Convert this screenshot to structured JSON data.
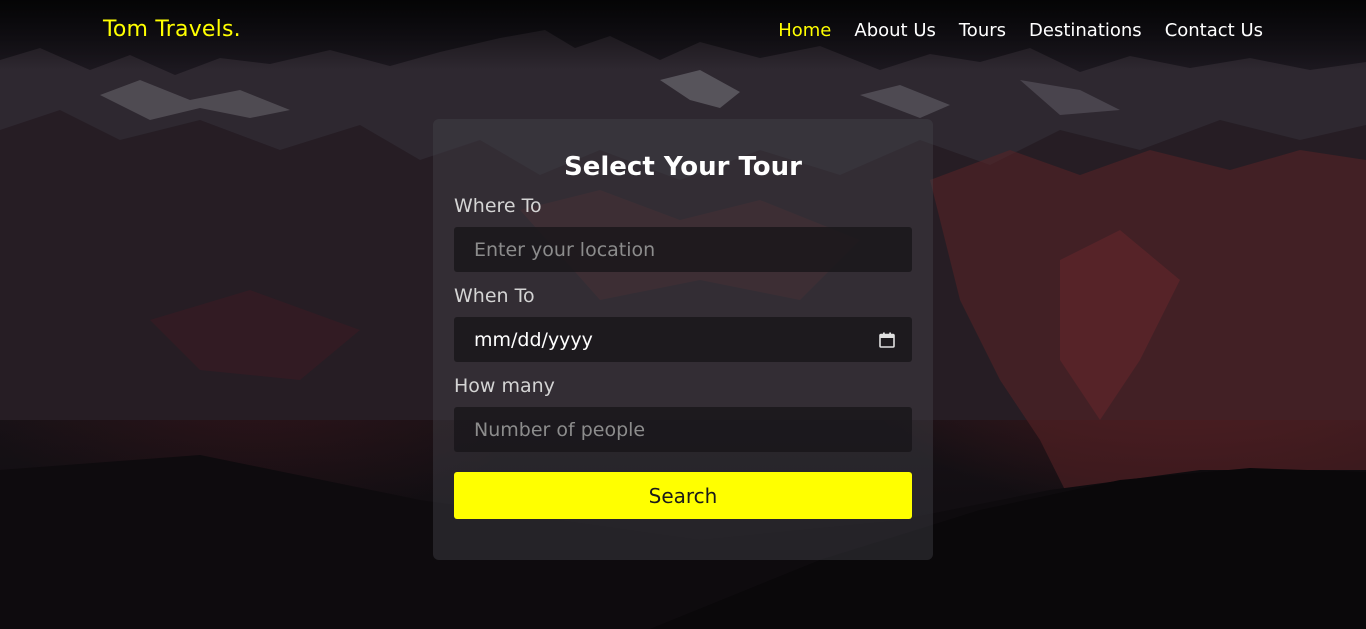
{
  "brand": {
    "name": "Tom Travels."
  },
  "nav": {
    "items": [
      {
        "label": "Home",
        "active": true
      },
      {
        "label": "About Us",
        "active": false
      },
      {
        "label": "Tours",
        "active": false
      },
      {
        "label": "Destinations",
        "active": false
      },
      {
        "label": "Contact Us",
        "active": false
      }
    ]
  },
  "form": {
    "title": "Select Your Tour",
    "where": {
      "label": "Where To",
      "placeholder": "Enter your location",
      "value": ""
    },
    "when": {
      "label": "When To",
      "value": "mm/dd/yyyy",
      "icon": "calendar-icon"
    },
    "howmany": {
      "label": "How many",
      "placeholder": "Number of people",
      "value": ""
    },
    "submit_label": "Search"
  },
  "colors": {
    "accent": "#ffff00",
    "text": "#ffffff",
    "label": "#d4d4d4",
    "card_bg": "rgba(68,68,76,0.42)",
    "input_bg": "rgba(24,22,26,0.82)"
  }
}
